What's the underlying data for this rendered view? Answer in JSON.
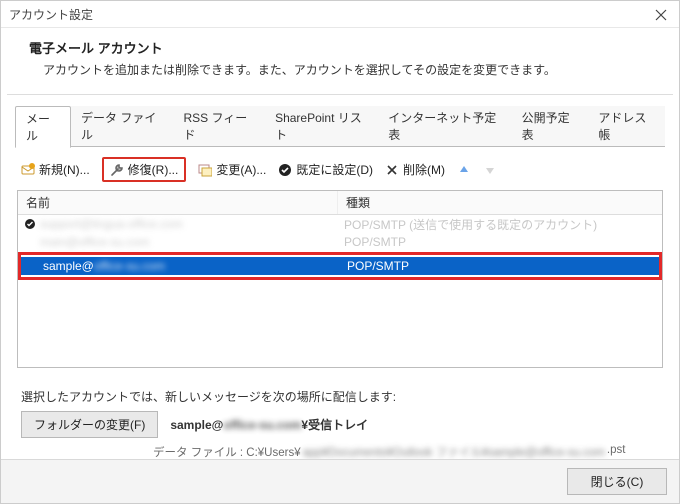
{
  "window": {
    "title": "アカウント設定",
    "close_icon": "close"
  },
  "header": {
    "title": "電子メール アカウント",
    "desc": "アカウントを追加または削除できます。また、アカウントを選択してその設定を変更できます。"
  },
  "tabs": [
    {
      "label": "メール",
      "active": true
    },
    {
      "label": "データ ファイル"
    },
    {
      "label": "RSS フィード"
    },
    {
      "label": "SharePoint リスト"
    },
    {
      "label": "インターネット予定表"
    },
    {
      "label": "公開予定表"
    },
    {
      "label": "アドレス帳"
    }
  ],
  "toolbar": {
    "new": "新規(N)...",
    "repair": "修復(R)...",
    "change": "変更(A)...",
    "default": "既定に設定(D)",
    "delete": "削除(M)"
  },
  "columns": {
    "name": "名前",
    "type": "種類"
  },
  "rows": [
    {
      "name": "support@lingua-office.com",
      "type": "POP/SMTP (送信で使用する既定のアカウント)",
      "default": true
    },
    {
      "name": "main@office-su.com",
      "type": "POP/SMTP"
    },
    {
      "name": "sample@office-su.com",
      "type": "POP/SMTP",
      "selected": true
    }
  ],
  "delivery": {
    "intro": "選択したアカウントでは、新しいメッセージを次の場所に配信します:",
    "folder_btn": "フォルダーの変更(F)",
    "account_prefix": "sample@",
    "account_blur": "office-su.com",
    "account_suffix": "¥受信トレイ",
    "datafile_label": "データ ファイル : C:¥Users¥",
    "datafile_blur": "app¥Documents¥Outlook ファイル¥sample@office-su.com",
    "datafile_suffix": ".pst"
  },
  "footer": {
    "close_btn": "閉じる(C)"
  }
}
